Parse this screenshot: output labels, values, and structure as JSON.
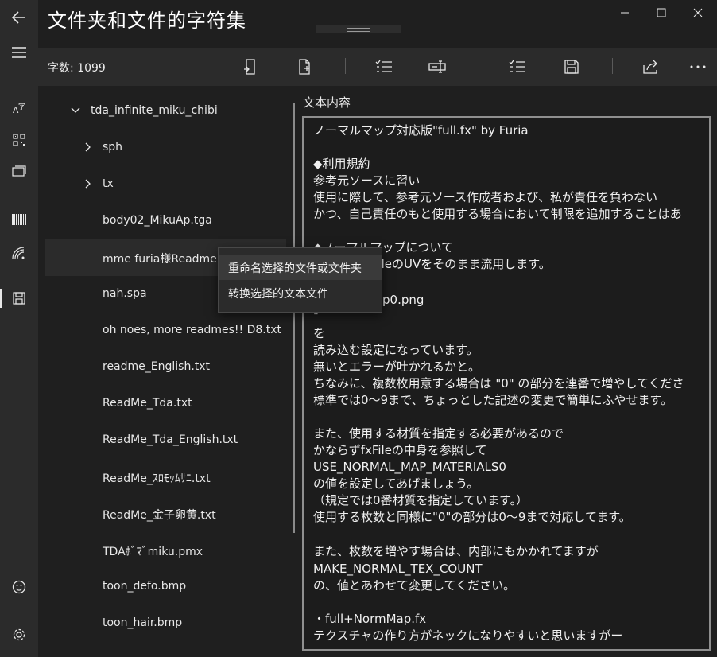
{
  "window": {
    "title": "文件夹和文件的字符集",
    "minimize_icon": "minimize-icon",
    "maximize_icon": "maximize-icon",
    "close_icon": "close-icon"
  },
  "rail": {
    "items": [
      "back-arrow-icon",
      "hamburger-menu-icon",
      "charset-icon",
      "qr-code-icon",
      "layers-icon",
      "barcode-icon",
      "wifi-icon",
      "save-drive-icon",
      "smiley-icon",
      "settings-gear-icon"
    ],
    "selected": "save-drive-icon"
  },
  "cmdbar": {
    "count_label": "字数: 1099",
    "buttons": [
      "open-file-icon",
      "new-file-icon",
      "checklist-icon",
      "rename-field-icon",
      "checklist-alt-icon",
      "save-icon",
      "share-icon",
      "more-icon"
    ]
  },
  "tree": {
    "root": "tda_infinite_miku_chibi",
    "folders": [
      "sph",
      "tx"
    ],
    "files": [
      "body02_MikuAp.tga",
      "mme furia様Readme.txt",
      "nah.spa",
      "oh noes, more readmes!! D8.txt",
      "readme_English.txt",
      "ReadMe_Tda.txt",
      "ReadMe_Tda_English.txt",
      "ReadMe_ｽﾛﾓｯﾑｻﾆ.txt",
      "ReadMe_金子卵黄.txt",
      "TDAﾎﾞﾏﾞmiku.pmx",
      "toon_defo.bmp",
      "toon_hair.bmp"
    ],
    "highlighted_file": "mme furia様Readme.txt",
    "highlighted_visible": "mme furia様Readme.t"
  },
  "context_menu": {
    "items": [
      "重命名选择的文件或文件夹",
      "转换选择的文本文件"
    ]
  },
  "content": {
    "label": "文本内容",
    "lines": [
      "ノーマルマップ対応版\"full.fx\" by Furia",
      "",
      "◆利用規約",
      "参考元ソースに習い",
      "使用に際して、参考元ソース作成者および、私が責任を負わない",
      "かつ、自己責任のもと使用する場合において制限を追加することはあ",
      "",
      "◆ノーマルマップについて",
      "xFileのUVをそのまま流用します。",
      "",
      "p0.png",
      "\"",
      "を",
      "読み込む設定になっています。",
      "無いとエラーが吐かれるかと。",
      "ちなみに、複数枚用意する場合は \"0\" の部分を連番で増やしてくださ",
      "標準では0～9まで、ちょっとした記述の変更で簡単にふやせます。",
      "",
      "また、使用する材質を指定する必要があるので",
      "かならずfxFileの中身を参照して",
      "USE_NORMAL_MAP_MATERIALS0",
      "の値を設定してあげましょう。",
      "（規定では0番材質を指定しています。）",
      "使用する枚数と同様に\"0\"の部分は0～9まで対応してます。",
      "",
      "また、枚数を増やす場合は、内部にもかかれてますが",
      "MAKE_NORMAL_TEX_COUNT",
      "の、値とあわせて変更してください。",
      "",
      "・full+NormMap.fx",
      "テクスチャの作り方がネックになりやすいと思いますがー"
    ]
  }
}
